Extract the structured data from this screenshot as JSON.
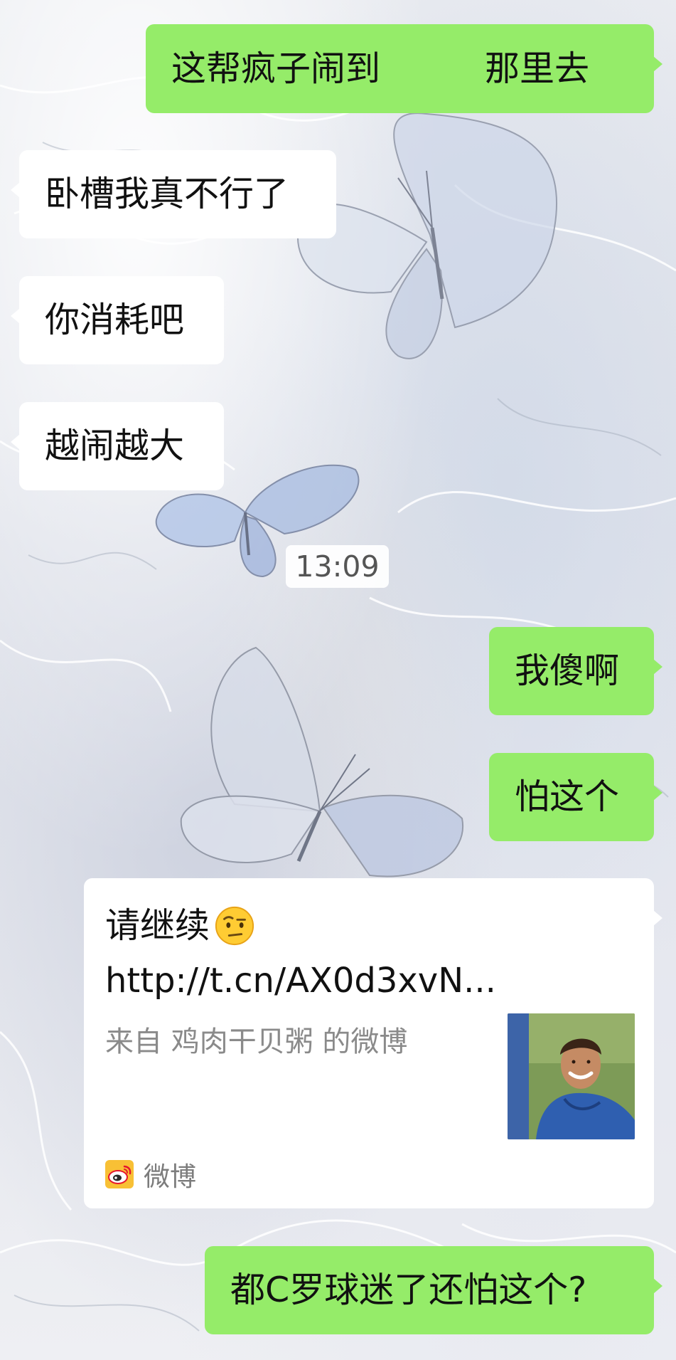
{
  "messages": {
    "m1": "这帮疯子闹到　　　那里去",
    "m2": "卧槽我真不行了",
    "m3": "你消耗吧",
    "m4": "越闹越大",
    "m5": "我傻啊",
    "m6": "怕这个",
    "m7": "都C罗球迷了还怕这个?"
  },
  "timestamp": "13:09",
  "share_card": {
    "title": "请继续",
    "emoji": "raised-eyebrow-face-icon",
    "url": "http://t.cn/AX0d3xvN...",
    "source": "来自 鸡肉干贝粥 的微博",
    "app_name": "微博",
    "app_icon": "weibo-logo-icon"
  },
  "colors": {
    "outgoing_bubble": "#95ec69",
    "incoming_bubble": "#ffffff",
    "timestamp_text": "#555555"
  }
}
